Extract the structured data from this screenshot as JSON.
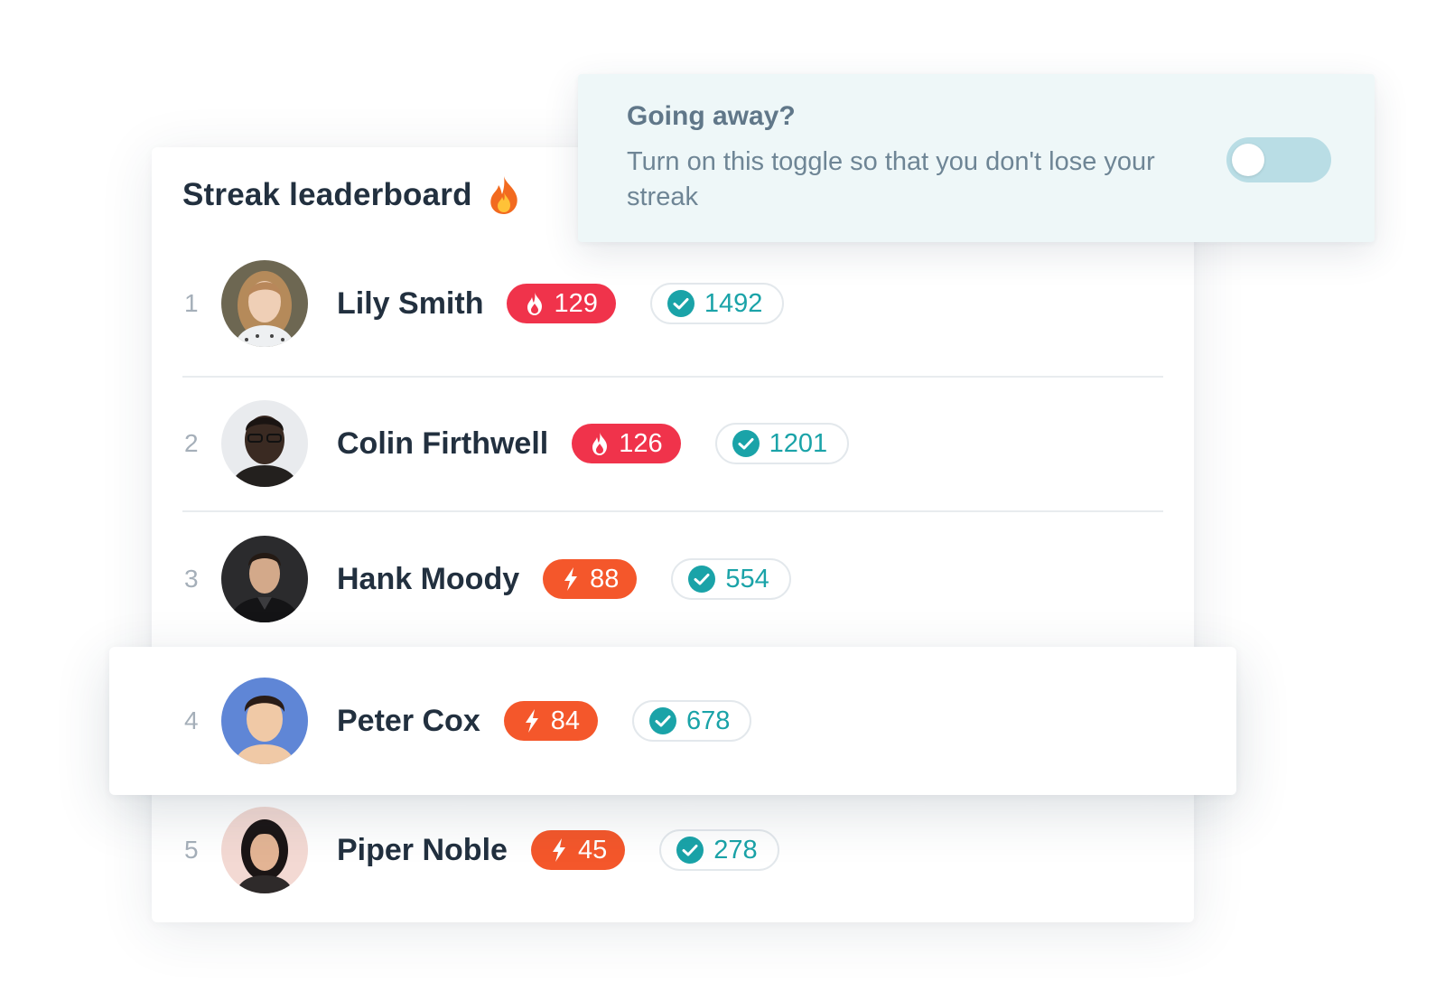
{
  "leaderboard": {
    "title": "Streak leaderboard",
    "title_icon": "fire-icon",
    "rows": [
      {
        "rank": "1",
        "name": "Lily Smith",
        "streak": "129",
        "streak_icon": "fire-icon",
        "score": "1492"
      },
      {
        "rank": "2",
        "name": "Colin Firthwell",
        "streak": "126",
        "streak_icon": "fire-icon",
        "score": "1201"
      },
      {
        "rank": "3",
        "name": "Hank Moody",
        "streak": "88",
        "streak_icon": "bolt-icon",
        "score": "554"
      },
      {
        "rank": "4",
        "name": "Peter Cox",
        "streak": "84",
        "streak_icon": "bolt-icon",
        "score": "678"
      },
      {
        "rank": "5",
        "name": "Piper Noble",
        "streak": "45",
        "streak_icon": "bolt-icon",
        "score": "278"
      }
    ]
  },
  "away_notice": {
    "title": "Going away?",
    "body": "Turn on this toggle so that you don't lose your streak",
    "toggle_on": false
  },
  "colors": {
    "fire_badge": "#f0334b",
    "bolt_badge": "#f4572b",
    "score_accent": "#1aa3a8",
    "notice_bg": "#eef7f8",
    "toggle_track": "#b9dde5"
  }
}
